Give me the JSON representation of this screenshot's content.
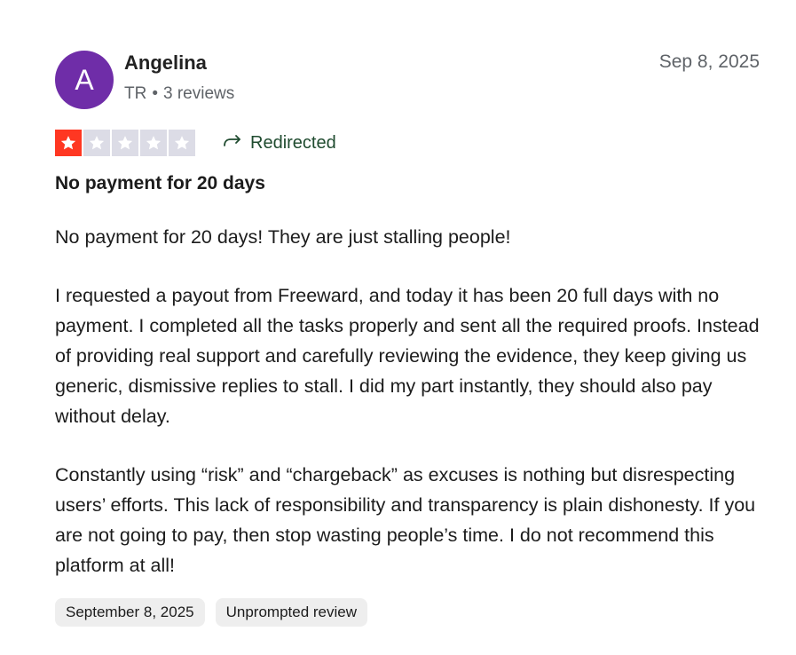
{
  "reviewer": {
    "avatar_letter": "A",
    "avatar_color": "#6f2da8",
    "name": "Angelina",
    "country": "TR",
    "separator": "•",
    "reviews_count": "3 reviews"
  },
  "review": {
    "date": "Sep 8, 2025",
    "rating": 1,
    "max_rating": 5,
    "star_filled_color": "#ff3722",
    "star_empty_color": "#dcdce6",
    "redirected_icon": "redirect-arrow-icon",
    "redirected_label": "Redirected",
    "title": "No payment for 20 days",
    "paragraphs": [
      "No payment for 20 days! They are just stalling people!",
      "I requested a payout from Freeward, and today it has been 20 full days with no payment. I completed all the tasks properly and sent all the required proofs. Instead of providing real support and carefully reviewing the evidence, they keep giving us generic, dismissive replies to stall. I did my part instantly, they should also pay without delay.",
      "Constantly using “risk” and “chargeback” as excuses is nothing but disrespecting users’ efforts. This lack of responsibility and transparency is plain dishonesty. If you are not going to pay, then stop wasting people’s time. I do not recommend this platform at all!"
    ],
    "tags": [
      "September 8, 2025",
      "Unprompted review"
    ]
  }
}
